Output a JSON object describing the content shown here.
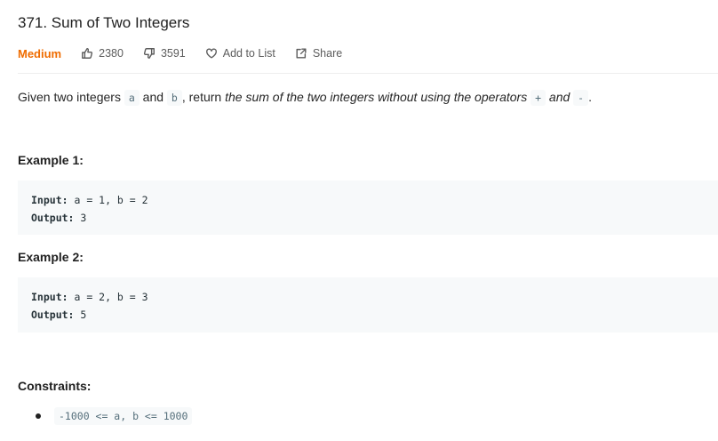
{
  "problem": {
    "title": "371. Sum of Two Integers",
    "difficulty": "Medium",
    "likes": "2380",
    "dislikes": "3591",
    "add_to_list": "Add to List",
    "share": "Share"
  },
  "description": {
    "part1": "Given two integers",
    "var_a": "a",
    "and": "and",
    "var_b": "b",
    "part2": ", return",
    "italic1": "the sum of the two integers without using the operators",
    "plus": "+",
    "and2": "and",
    "minus": "-",
    "period": "."
  },
  "examples": [
    {
      "heading": "Example 1:",
      "input_label": "Input:",
      "input_value": " a = 1, b = 2",
      "output_label": "Output:",
      "output_value": " 3"
    },
    {
      "heading": "Example 2:",
      "input_label": "Input:",
      "input_value": " a = 2, b = 3",
      "output_label": "Output:",
      "output_value": " 5"
    }
  ],
  "constraints": {
    "heading": "Constraints:",
    "items": [
      "-1000 <= a, b <= 1000"
    ]
  },
  "colors": {
    "difficulty": "#ef6c00",
    "code_bg": "#f7f9fa"
  },
  "icons": [
    "thumbs-up-icon",
    "thumbs-down-icon",
    "heart-icon",
    "share-icon"
  ]
}
